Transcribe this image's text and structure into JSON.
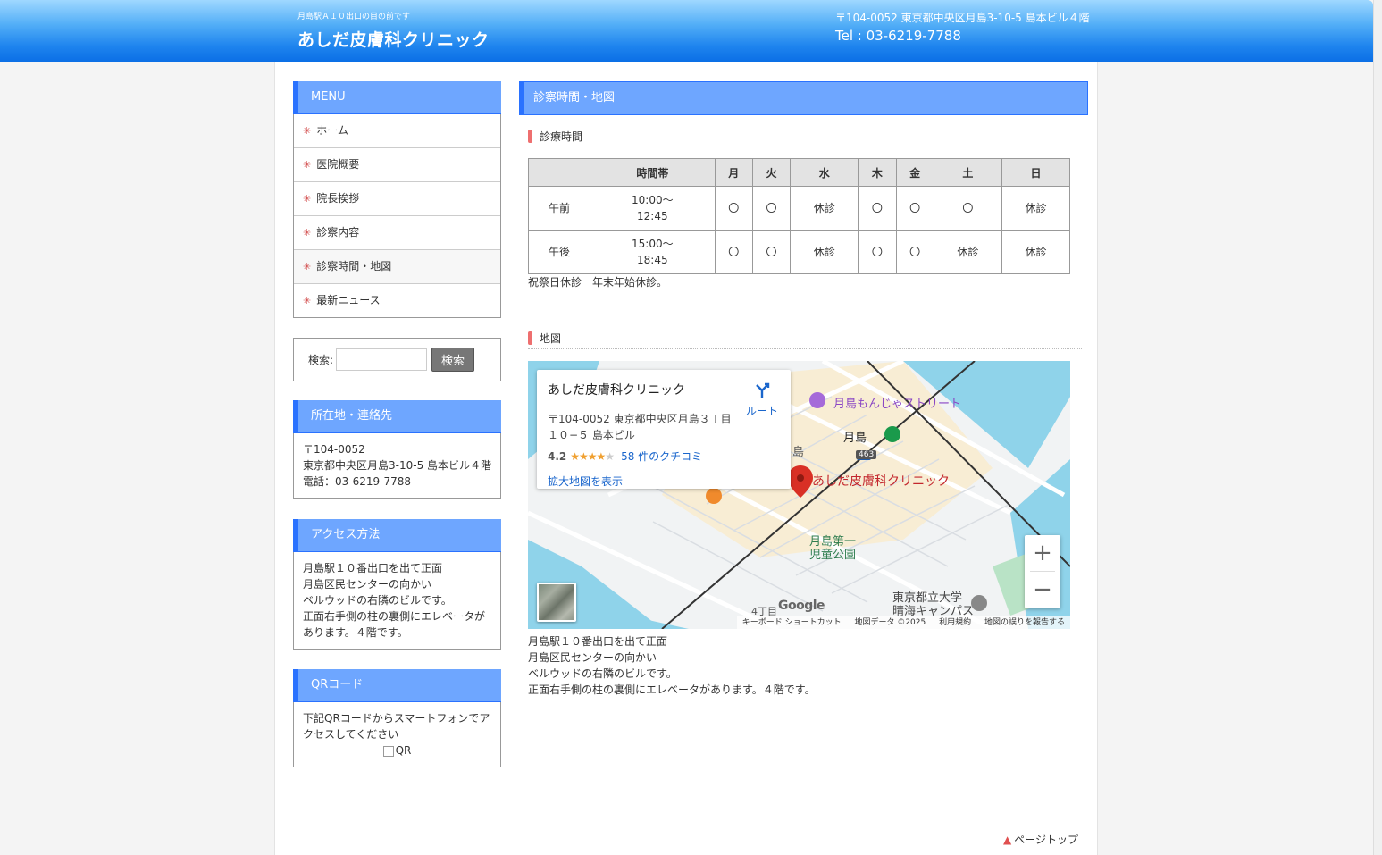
{
  "header": {
    "tagline": "月島駅Ａ１０出口の目の前です",
    "title": "あしだ皮膚科クリニック",
    "address": "〒104-0052 東京都中央区月島3-10-5 島本ビル４階",
    "tel": "Tel : 03-6219-7788"
  },
  "sidebar": {
    "menu_title": "MENU",
    "menu_items": [
      {
        "label": "ホーム"
      },
      {
        "label": "医院概要"
      },
      {
        "label": "院長挨拶"
      },
      {
        "label": "診察内容"
      },
      {
        "label": "診察時間・地図"
      },
      {
        "label": "最新ニュース"
      }
    ],
    "search": {
      "label": "検索:",
      "button": "検索"
    },
    "location": {
      "title": "所在地・連絡先",
      "lines": [
        "〒104-0052",
        "東京都中央区月島3-10-5 島本ビル４階",
        "電話：03-6219-7788"
      ]
    },
    "access": {
      "title": "アクセス方法",
      "lines": [
        "月島駅１０番出口を出て正面",
        "月島区民センターの向かい",
        "ベルウッドの右隣のビルです。",
        "正面右手側の柱の裏側にエレベータが",
        "あります。４階です。"
      ]
    },
    "qr": {
      "title": "QRコード",
      "lines": [
        "下記QRコードからスマートフォンでア",
        "クセスしてください"
      ],
      "alt": "QR"
    }
  },
  "main": {
    "title": "診察時間・地図",
    "hours_heading": "診療時間",
    "table": {
      "headers": [
        "",
        "時間帯",
        "月",
        "火",
        "水",
        "木",
        "金",
        "土",
        "日"
      ],
      "rows": [
        [
          "午前",
          "10:00～\n12:45",
          "〇",
          "〇",
          "休診",
          "〇",
          "〇",
          "〇",
          "休診"
        ],
        [
          "午後",
          "15:00～\n18:45",
          "〇",
          "〇",
          "休診",
          "〇",
          "〇",
          "休診",
          "休診"
        ]
      ]
    },
    "note": "祝祭日休診　年末年始休診。",
    "map_heading": "地図",
    "map": {
      "card_name": "あしだ皮膚科クリニック",
      "card_address": "〒104-0052 東京都中央区月島３丁目１０−５ 島本ビル",
      "rating": "4.2",
      "stars": "★★★★",
      "star_off": "★",
      "reviews": "58 件のクチコミ",
      "enlarge": "拡大地図を表示",
      "route": "ルート",
      "labels": {
        "clinic": "あしだ皮膚科クリニック",
        "street": "月島もんじゃストリート",
        "station": "月島",
        "park_1": "月島第一",
        "park_2": "児童公園",
        "univ_1": "東京都立大学",
        "univ_2": "晴海キャンパス",
        "chome": "4丁目",
        "shima": "島",
        "road": "463"
      },
      "google": "Google",
      "attribution": [
        "キーボード ショートカット",
        "地図データ ©2025",
        "利用規約",
        "地図の誤りを報告する"
      ],
      "zoom_in": "+",
      "zoom_out": "−"
    },
    "access_lines": [
      "月島駅１０番出口を出て正面",
      "月島区民センターの向かい",
      "ベルウッドの右隣のビルです。",
      "正面右手側の柱の裏側にエレベータがあります。４階です。"
    ],
    "pagetop": "ページトップ"
  },
  "colors": {
    "header_blue": "#1e84ee",
    "box_head": "#6ea6ff",
    "accent_red": "#ee6f6f",
    "marker_red": "#d93025"
  }
}
